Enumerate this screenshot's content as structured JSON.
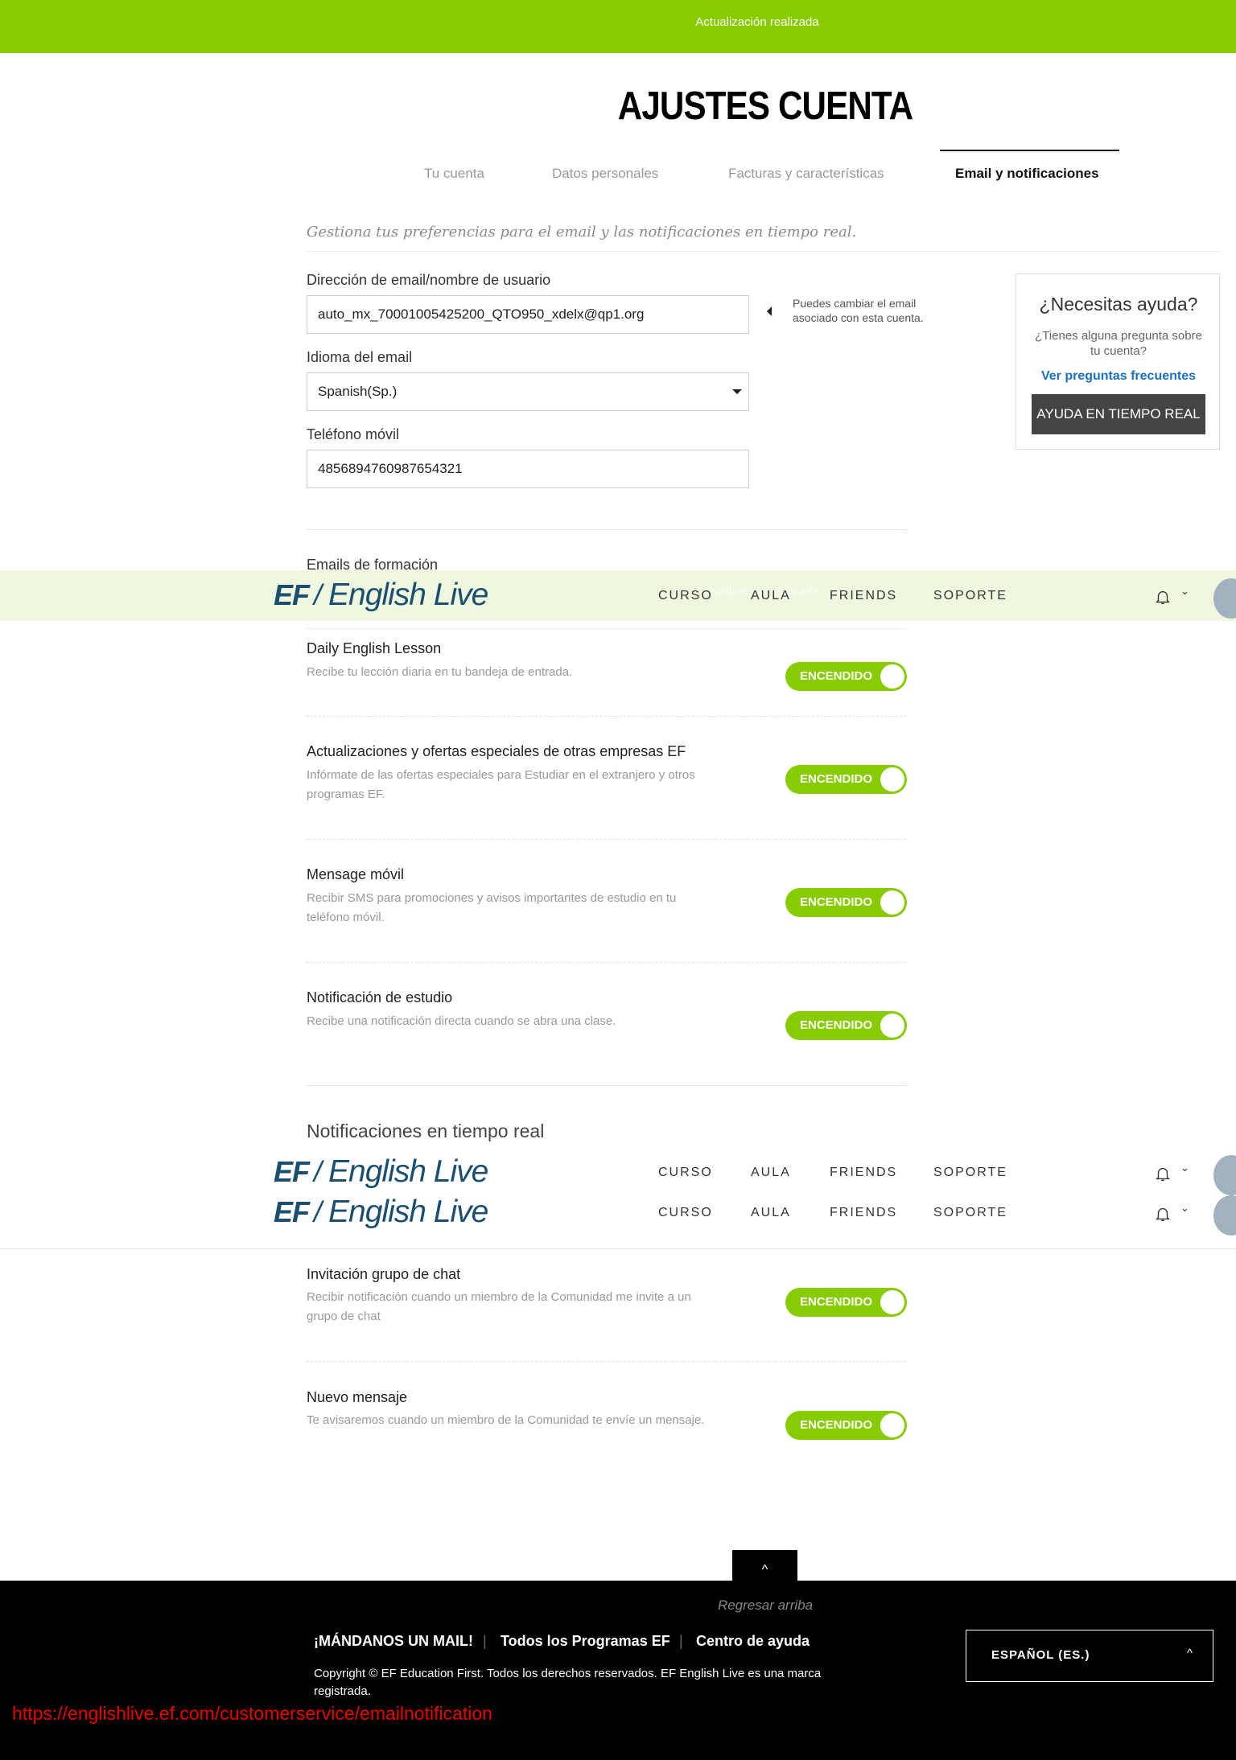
{
  "banner": {
    "text": "Actualización realizada"
  },
  "page": {
    "title": "AJUSTES CUENTA"
  },
  "tabs": [
    {
      "label": "Tu cuenta"
    },
    {
      "label": "Datos personales"
    },
    {
      "label": "Facturas y características"
    },
    {
      "label": "Email y notificaciones",
      "active": true
    }
  ],
  "intro": "Gestiona tus preferencias para el email y las notificaciones en tiempo real.",
  "form": {
    "email_label": "Dirección de email/nombre de usuario",
    "email_value": "auto_mx_70001005425200_QTO950_xdelx@qp1.org",
    "email_tip": "Puedes cambiar el email asociado con esta cuenta.",
    "language_label": "Idioma del email",
    "language_value": "Spanish(Sp.)",
    "phone_label": "Teléfono móvil",
    "phone_value": "4856894760987654321"
  },
  "help": {
    "title": "¿Necesitas ayuda?",
    "subtitle": "¿Tienes alguna pregunta sobre tu cuenta?",
    "faq_link": "Ver preguntas frecuentes",
    "live_button": "AYUDA EN TIEMPO REAL"
  },
  "sections": {
    "emails_title": "Emails de formación",
    "realtime_title": "Notificaciones en tiempo real"
  },
  "nav": {
    "overlay_text": "Actualización realizada",
    "items": [
      "CURSO",
      "AULA",
      "FRIENDS",
      "SOPORTE"
    ],
    "brand": "English Live",
    "brand_mark": "EF",
    "chevron": "⌄"
  },
  "email_items": [
    {
      "title": "Daily English Lesson",
      "desc": "Recibe tu lección diaria en tu bandeja de entrada.",
      "toggle": "ENCENDIDO"
    },
    {
      "title": "Actualizaciones y ofertas especiales de otras empresas EF",
      "desc": "Infórmate de las ofertas especiales para Estudiar en el extranjero y otros programas EF.",
      "toggle": "ENCENDIDO"
    },
    {
      "title": "Mensage móvil",
      "desc": "Recibir SMS para promociones y avisos importantes de estudio en tu teléfono móvil.",
      "toggle": "ENCENDIDO"
    },
    {
      "title": "Notificación de estudio",
      "desc": "Recibe una notificación directa cuando se abra una clase.",
      "toggle": "ENCENDIDO"
    }
  ],
  "realtime_items": [
    {
      "title": "Invitación grupo de chat",
      "desc": "Recibir notificación cuando un miembro de la Comunidad me invite a un grupo de chat",
      "toggle": "ENCENDIDO"
    },
    {
      "title": "Nuevo mensaje",
      "desc": "Te avisaremos cuando un miembro de la Comunidad te envíe un mensaje.",
      "toggle": "ENCENDIDO"
    }
  ],
  "back_to_top": {
    "label": "Regresar arriba",
    "icon": "^"
  },
  "footer": {
    "links": [
      "¡MÁNDANOS UN MAIL!",
      "Todos los Programas EF",
      "Centro de ayuda"
    ],
    "separator": "|",
    "copyright": "Copyright © EF Education First. Todos los derechos reservados. EF English Live es una marca registrada.",
    "language": "ESPAÑOL (ES.)",
    "language_chevron": "^"
  },
  "status_url": "https://englishlive.ef.com/customerservice/emailnotification",
  "colors": {
    "accent": "#86cc00",
    "brand": "#1b4f72",
    "link": "#1a6fc0"
  }
}
